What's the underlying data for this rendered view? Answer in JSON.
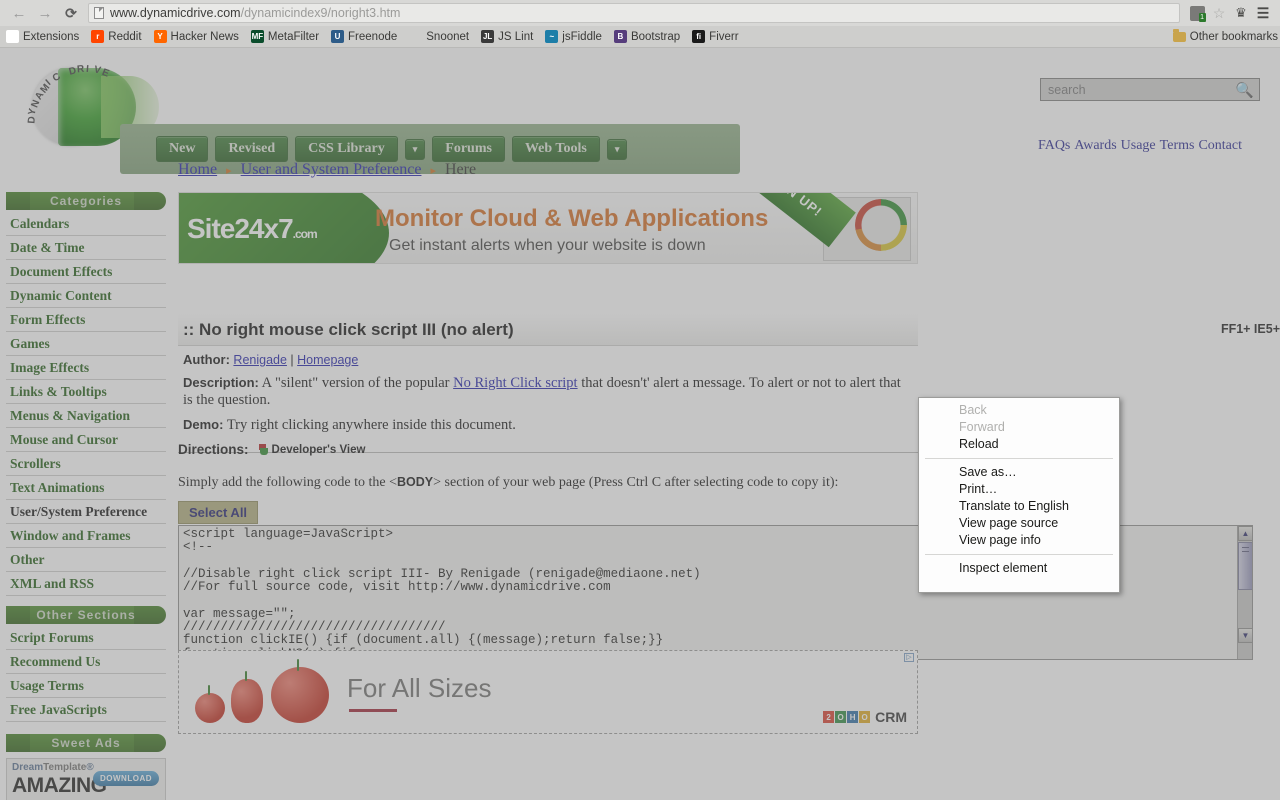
{
  "browser": {
    "nav": {
      "back": "←",
      "forward": "→",
      "reload": "⟳"
    },
    "url_domain": "www.dynamicdrive.com",
    "url_path": "/dynamicindex9/noright3.htm",
    "omnibox_icon": "page-document-icon",
    "toolbar_icons": [
      "extension-badge-icon",
      "bookmark-star-icon",
      "crown-extension-icon",
      "hamburger-menu-icon"
    ],
    "bookmarks": [
      {
        "label": "Extensions",
        "icon": "page-icon",
        "color": "#ffffff",
        "glyph": ""
      },
      {
        "label": "Reddit",
        "icon": "reddit-icon",
        "color": "#ff4500",
        "glyph": "r"
      },
      {
        "label": "Hacker News",
        "icon": "hackernews-icon",
        "color": "#ff6600",
        "glyph": "Y"
      },
      {
        "label": "MetaFilter",
        "icon": "metafilter-icon",
        "color": "#0b4d2c",
        "glyph": "MF"
      },
      {
        "label": "Freenode",
        "icon": "freenode-icon",
        "color": "#2e5c88",
        "glyph": "U"
      },
      {
        "label": "Snoonet",
        "icon": "snoonet-leaf-icon",
        "color": "#8fbе55",
        "glyph": ""
      },
      {
        "label": "JS Lint",
        "icon": "jslint-icon",
        "color": "#3a3a3a",
        "glyph": "JL"
      },
      {
        "label": "jsFiddle",
        "icon": "jsfiddle-cloud-icon",
        "color": "#1d7ea8",
        "glyph": "~"
      },
      {
        "label": "Bootstrap",
        "icon": "bootstrap-icon",
        "color": "#563d7c",
        "glyph": "B"
      },
      {
        "label": "Fiverr",
        "icon": "fiverr-icon",
        "color": "#1a1a1a",
        "glyph": "fi"
      }
    ],
    "other_bookmarks": "Other bookmarks"
  },
  "site": {
    "logo_text": "DYNAMIC DRIVE",
    "nav": [
      {
        "label": "New",
        "type": "pill"
      },
      {
        "label": "Revised",
        "type": "pill"
      },
      {
        "label": "CSS Library",
        "type": "pill"
      },
      {
        "label": "▾",
        "type": "arrow"
      },
      {
        "label": "Forums",
        "type": "pill"
      },
      {
        "label": "Web Tools",
        "type": "pill"
      },
      {
        "label": "▾",
        "type": "arrow"
      }
    ],
    "search": {
      "placeholder": "search",
      "value": "",
      "icon": "search-magnifier-icon"
    },
    "top_links": [
      "FAQs",
      "Awards",
      "Usage",
      "Terms",
      "Contact"
    ]
  },
  "breadcrumb": {
    "home": "Home",
    "category": "User and System Preference",
    "current": "Here",
    "separator": "▸"
  },
  "sidebar": {
    "categories_heading": "Categories",
    "categories": [
      "Calendars",
      "Date & Time",
      "Document Effects",
      "Dynamic Content",
      "Form Effects",
      "Games",
      "Image Effects",
      "Links & Tooltips",
      "Menus & Navigation",
      "Mouse and Cursor",
      "Scrollers",
      "Text Animations",
      "User/System Preference",
      "Window and Frames",
      "Other",
      "XML and RSS"
    ],
    "active_category": "User/System Preference",
    "other_sections_heading": "Other Sections",
    "other_sections": [
      "Script Forums",
      "Recommend Us",
      "Usage Terms",
      "Free JavaScripts"
    ],
    "sweet_ads_heading": "Sweet Ads",
    "ad": {
      "brand": "Dream",
      "brand2": "Template",
      "sup": "®",
      "headline": "AMAZING",
      "cta": "DOWNLOAD"
    }
  },
  "banner": {
    "logo": "Site24x7",
    "logo_sub": ".com",
    "headline": "Monitor Cloud & Web Applications",
    "subhead": "Get instant alerts when your website is down",
    "ribbon": "SIGN UP!"
  },
  "article": {
    "title": ":: No right mouse click script III (no alert)",
    "compat": "FF1+ IE5+",
    "author_label": "Author:",
    "author_name": "Renigade",
    "author_sep": "|",
    "author_homepage": "Homepage",
    "description_label": "Description:",
    "description_part1": "A \"silent\" version of the popular ",
    "description_link": "No Right Click script",
    "description_part2": " that doesn't' alert a message. To alert or not to alert that is the question.",
    "demo_label": "Demo:",
    "demo_text": "Try right clicking anywhere inside this document."
  },
  "directions": {
    "label": "Directions:",
    "dev_view": "Developer's View",
    "instruction_part1": "Simply add the following code to the <",
    "instruction_bold": "BODY",
    "instruction_part2": "> section of your web page (Press Ctrl C after selecting code to copy it):",
    "select_all_label": "Select All",
    "code": "<script language=JavaScript>\n<!--\n\n//Disable right click script III- By Renigade (renigade@mediaone.net)\n//For full source code, visit http://www.dynamicdrive.com\n\nvar message=\"\";\n///////////////////////////////////\nfunction clickIE() {if (document.all) {(message);return false;}}\nfunction clickNS(e) {if"
  },
  "bottom_ad": {
    "headline": "For All Sizes",
    "brand": "CRM",
    "zoho_letters": [
      "2",
      "O",
      "H",
      "O"
    ],
    "adchoice": "▷"
  },
  "context_menu": {
    "items": [
      {
        "label": "Back",
        "disabled": true
      },
      {
        "label": "Forward",
        "disabled": true
      },
      {
        "label": "Reload",
        "disabled": false
      },
      {
        "separator": true
      },
      {
        "label": "Save as…",
        "disabled": false
      },
      {
        "label": "Print…",
        "disabled": false
      },
      {
        "label": "Translate to English",
        "disabled": false
      },
      {
        "label": "View page source",
        "disabled": false
      },
      {
        "label": "View page info",
        "disabled": false
      },
      {
        "separator": true
      },
      {
        "label": "Inspect element",
        "disabled": false
      }
    ]
  },
  "colors": {
    "brand_green": "#2d5e14",
    "link_blue": "#1a1aa8",
    "accent_orange": "#d2691e",
    "chrome_gray": "#d6d6d4"
  }
}
